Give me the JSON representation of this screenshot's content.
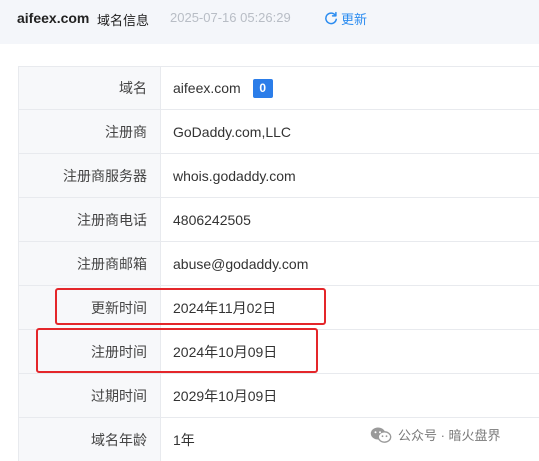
{
  "header": {
    "domain": "aifeex.com",
    "label": "域名信息",
    "time": "2025-07-16 05:26:29",
    "refresh_label": "更新",
    "refresh_icon": "refresh-icon"
  },
  "rows": [
    {
      "key": "域名",
      "value": "aifeex.com",
      "badge": "0"
    },
    {
      "key": "注册商",
      "value": "GoDaddy.com,LLC"
    },
    {
      "key": "注册商服务器",
      "value": "whois.godaddy.com"
    },
    {
      "key": "注册商电话",
      "value": "4806242505"
    },
    {
      "key": "注册商邮箱",
      "value": "abuse@godaddy.com"
    },
    {
      "key": "更新时间",
      "value": "2024年11月02日"
    },
    {
      "key": "注册时间",
      "value": "2024年10月09日"
    },
    {
      "key": "过期时间",
      "value": "2029年10月09日"
    },
    {
      "key": "域名年龄",
      "value": "1年"
    }
  ],
  "watermark": {
    "text": "公众号 · 暗火盘界",
    "icon": "wechat-icon"
  },
  "colors": {
    "accent": "#2b8cf0",
    "badge": "#2b7de9",
    "highlight": "#e4262a",
    "header_bg": "#f4f6fa",
    "key_bg": "#f7f8fa"
  }
}
